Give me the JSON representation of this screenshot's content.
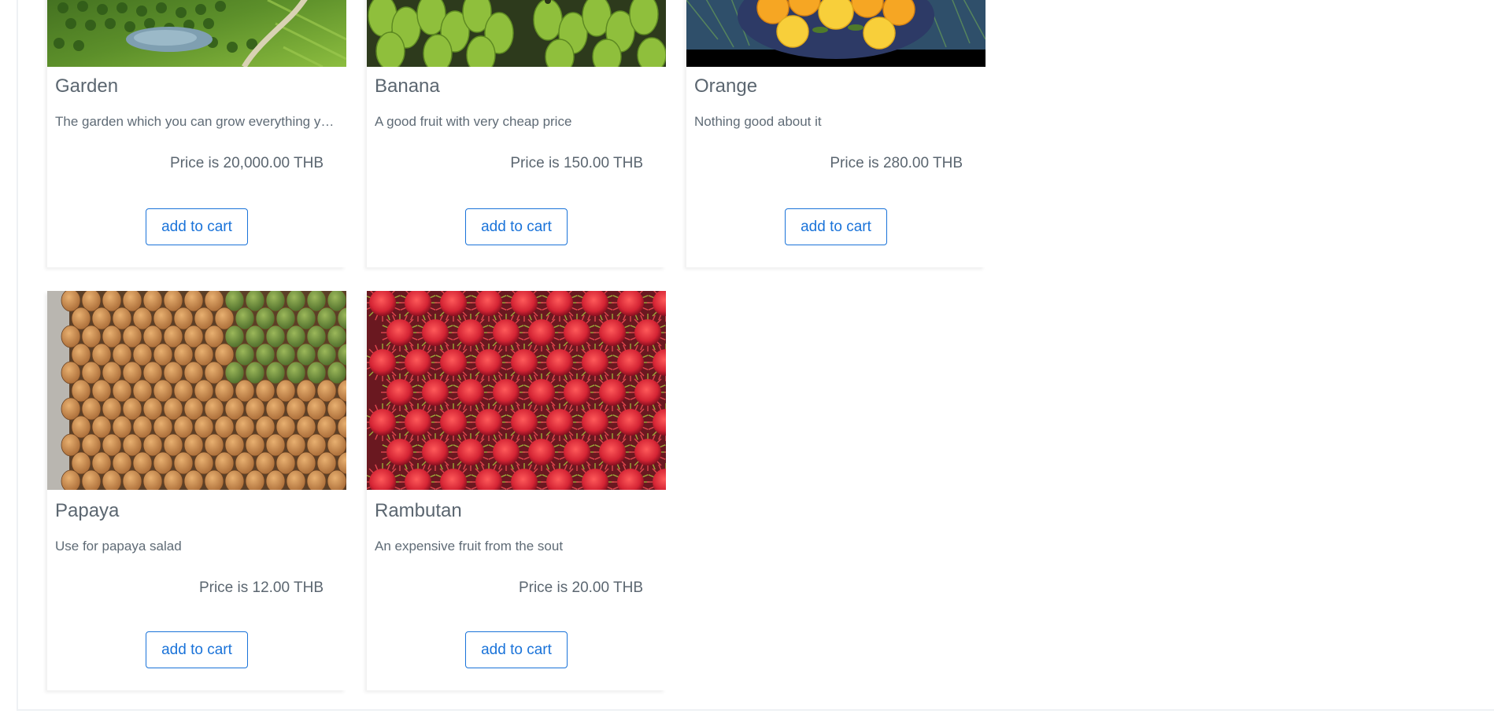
{
  "products": [
    {
      "name": "Garden",
      "description": "The garden which you can grow everything you want",
      "price": "Price is 20,000.00 THB",
      "button": "add to cart"
    },
    {
      "name": "Banana",
      "description": "A good fruit with very cheap price",
      "price": "Price is 150.00 THB",
      "button": "add to cart"
    },
    {
      "name": "Orange",
      "description": "Nothing good about it",
      "price": "Price is 280.00 THB",
      "button": "add to cart"
    },
    {
      "name": "Papaya",
      "description": "Use for papaya salad",
      "price": "Price is 12.00 THB",
      "button": "add to cart"
    },
    {
      "name": "Rambutan",
      "description": "An expensive fruit from the sout",
      "price": "Price is 20.00 THB",
      "button": "add to cart"
    }
  ]
}
